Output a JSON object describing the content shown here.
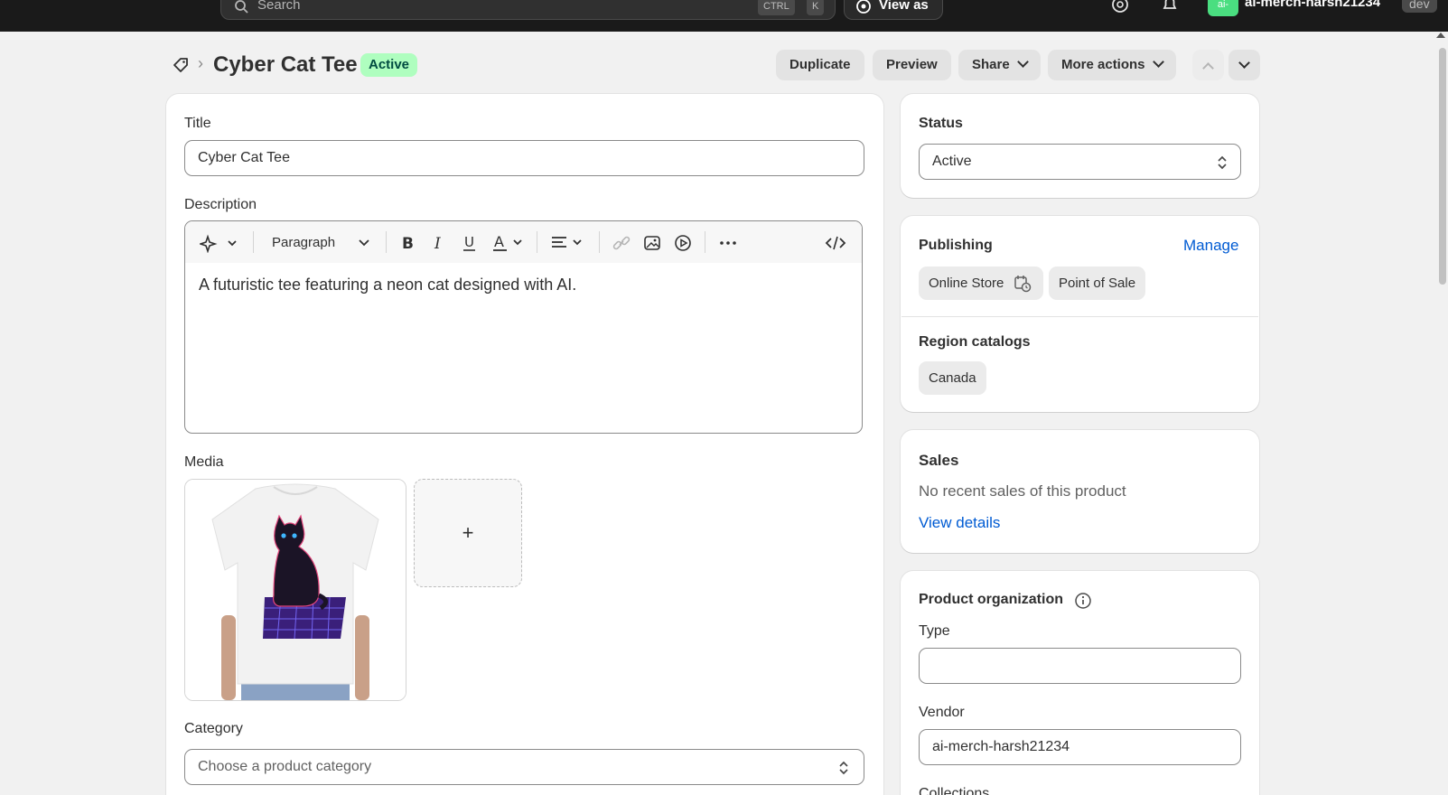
{
  "topbar": {
    "search_placeholder": "Search",
    "kbd_ctrl": "CTRL",
    "kbd_k": "K",
    "view_as_label": "View as",
    "avatar_initials": "ai-",
    "store_name": "ai-merch-harsh21234",
    "store_badge": "dev"
  },
  "header": {
    "title": "Cyber Cat Tee",
    "status_badge": "Active",
    "buttons": {
      "duplicate": "Duplicate",
      "preview": "Preview",
      "share": "Share",
      "more_actions": "More actions"
    }
  },
  "main": {
    "title_label": "Title",
    "title_value": "Cyber Cat Tee",
    "description_label": "Description",
    "toolbar": {
      "paragraph": "Paragraph"
    },
    "description_text": "A futuristic tee featuring a neon cat designed with AI.",
    "media_label": "Media",
    "media_add": "+",
    "category_label": "Category",
    "category_placeholder": "Choose a product category"
  },
  "sidebar": {
    "status": {
      "heading": "Status",
      "value": "Active"
    },
    "publishing": {
      "heading": "Publishing",
      "manage": "Manage",
      "channels": [
        "Online Store",
        "Point of Sale"
      ],
      "region_heading": "Region catalogs",
      "regions": [
        "Canada"
      ]
    },
    "sales": {
      "heading": "Sales",
      "text": "No recent sales of this product",
      "link": "View details"
    },
    "organization": {
      "heading": "Product organization",
      "type_label": "Type",
      "type_value": "",
      "vendor_label": "Vendor",
      "vendor_value": "ai-merch-harsh21234",
      "collections_label": "Collections"
    }
  },
  "colors": {
    "accent_link": "#005bd3",
    "active_badge_bg": "#affebf",
    "active_badge_text": "#014b40",
    "topbar_bg": "#1a1a1a"
  }
}
